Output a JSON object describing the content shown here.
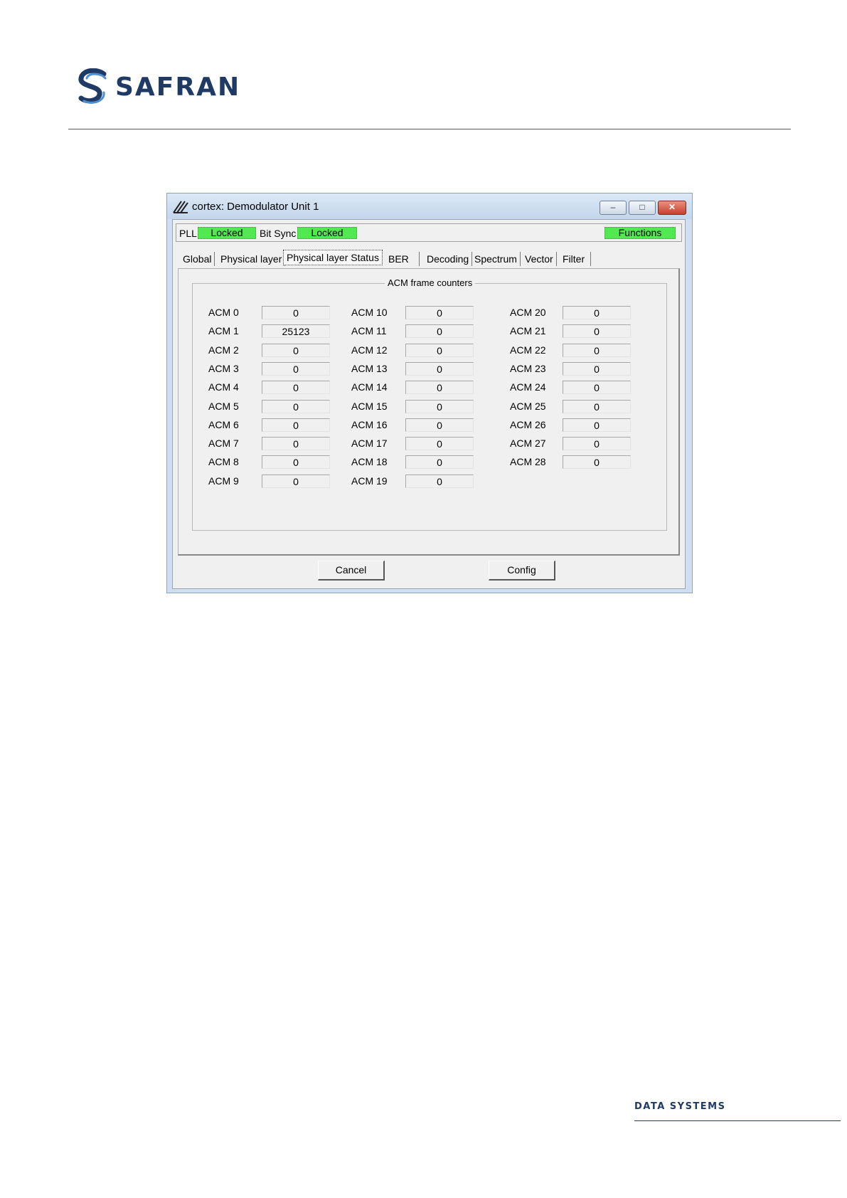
{
  "brand": {
    "name": "SAFRAN",
    "footer": "DATA SYSTEMS",
    "accent": "#1f3a64"
  },
  "window": {
    "title": "cortex: Demodulator Unit 1",
    "controls": {
      "minimize": "–",
      "maximize": "□",
      "close": "✕"
    }
  },
  "status": {
    "pll_label": "PLL",
    "pll_value": "Locked",
    "bitsync_label": "Bit Sync",
    "bitsync_value": "Locked",
    "functions": "Functions",
    "ok_color": "#52e852"
  },
  "tabs": [
    "Global",
    "Physical layer",
    "Physical layer Status",
    "BER",
    "Decoding",
    "Spectrum",
    "Vector",
    "Filter"
  ],
  "active_tab": "Physical layer Status",
  "group": {
    "title": "ACM frame counters",
    "counters": [
      {
        "label": "ACM 0",
        "value": "0"
      },
      {
        "label": "ACM 1",
        "value": "25123"
      },
      {
        "label": "ACM 2",
        "value": "0"
      },
      {
        "label": "ACM 3",
        "value": "0"
      },
      {
        "label": "ACM 4",
        "value": "0"
      },
      {
        "label": "ACM 5",
        "value": "0"
      },
      {
        "label": "ACM 6",
        "value": "0"
      },
      {
        "label": "ACM 7",
        "value": "0"
      },
      {
        "label": "ACM 8",
        "value": "0"
      },
      {
        "label": "ACM 9",
        "value": "0"
      },
      {
        "label": "ACM 10",
        "value": "0"
      },
      {
        "label": "ACM 11",
        "value": "0"
      },
      {
        "label": "ACM 12",
        "value": "0"
      },
      {
        "label": "ACM 13",
        "value": "0"
      },
      {
        "label": "ACM 14",
        "value": "0"
      },
      {
        "label": "ACM 15",
        "value": "0"
      },
      {
        "label": "ACM 16",
        "value": "0"
      },
      {
        "label": "ACM 17",
        "value": "0"
      },
      {
        "label": "ACM 18",
        "value": "0"
      },
      {
        "label": "ACM 19",
        "value": "0"
      },
      {
        "label": "ACM 20",
        "value": "0"
      },
      {
        "label": "ACM 21",
        "value": "0"
      },
      {
        "label": "ACM 22",
        "value": "0"
      },
      {
        "label": "ACM 23",
        "value": "0"
      },
      {
        "label": "ACM 24",
        "value": "0"
      },
      {
        "label": "ACM 25",
        "value": "0"
      },
      {
        "label": "ACM 26",
        "value": "0"
      },
      {
        "label": "ACM 27",
        "value": "0"
      },
      {
        "label": "ACM 28",
        "value": "0"
      }
    ]
  },
  "buttons": {
    "cancel": "Cancel",
    "config": "Config"
  }
}
